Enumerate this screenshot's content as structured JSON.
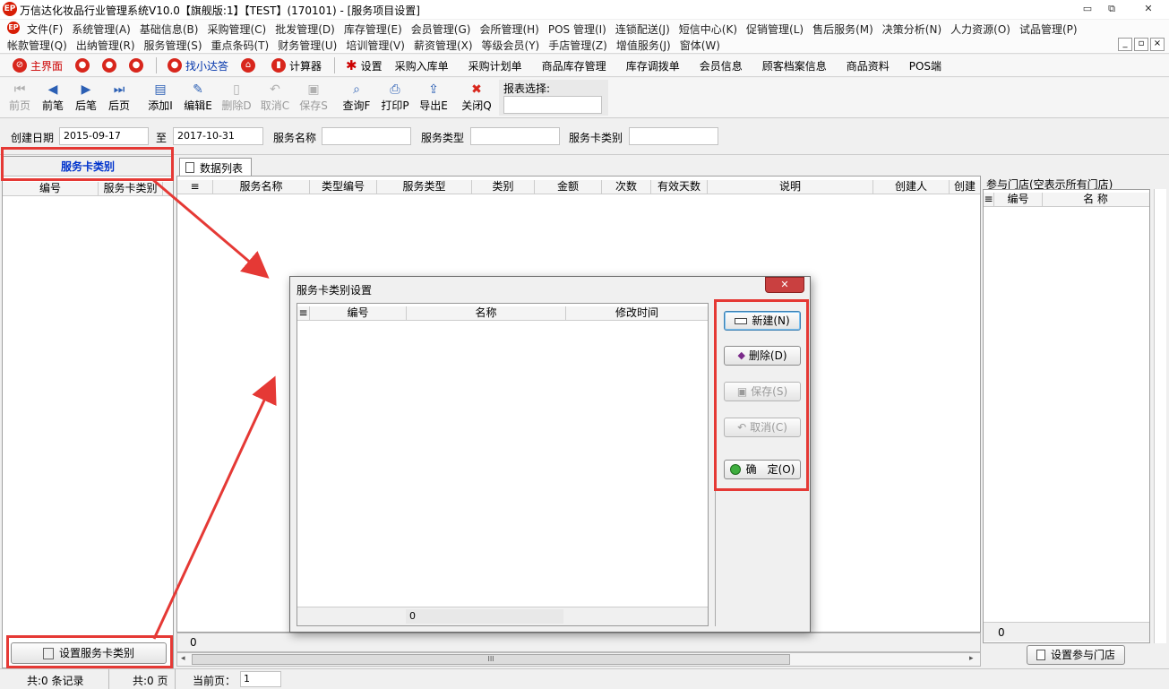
{
  "window": {
    "title": "万信达化妆品行业管理系统V10.0【旗舰版:1】【TEST】(170101) - [服务项目设置]",
    "logo": "EP",
    "min": "▭",
    "restore": "⧉",
    "close": "✕"
  },
  "menu": {
    "row1": [
      "文件(F)",
      "系统管理(A)",
      "基础信息(B)",
      "采购管理(C)",
      "批发管理(D)",
      "库存管理(E)",
      "会员管理(G)",
      "会所管理(H)",
      "POS 管理(I)",
      "连锁配送(J)",
      "短信中心(K)",
      "促销管理(L)",
      "售后服务(M)",
      "决策分析(N)",
      "人力资源(O)",
      "试品管理(P)"
    ],
    "row2": [
      "帐款管理(Q)",
      "出纳管理(R)",
      "服务管理(S)",
      "重点条码(T)",
      "财务管理(U)",
      "培训管理(V)",
      "薪资管理(X)",
      "等级会员(Y)",
      "手店管理(Z)",
      "增值服务(J)",
      "窗体(W)"
    ],
    "mdi_controls": [
      "_",
      "▫",
      "×"
    ]
  },
  "quickbar": {
    "home": "主界面",
    "find": "找小达答",
    "calc": "计算器",
    "settings": "设置",
    "links": [
      "采购入库单",
      "采购计划单",
      "商品库存管理",
      "库存调拨单",
      "会员信息",
      "顾客档案信息",
      "商品资料",
      "POS端"
    ]
  },
  "toolbar": {
    "buttons": [
      "前页",
      "前笔",
      "后笔",
      "后页",
      "添加I",
      "编辑E",
      "删除D",
      "取消C",
      "保存S",
      "查询F",
      "打印P",
      "导出E",
      "关闭Q"
    ],
    "report_label": "报表选择:"
  },
  "filter": {
    "date_label": "创建日期",
    "date_from": "2015-09-17",
    "to_label": "至",
    "date_to": "2017-10-31",
    "name_label": "服务名称",
    "type_label": "服务类型",
    "cardtype_label": "服务卡类别"
  },
  "left": {
    "title": "服务卡类别",
    "columns": [
      "编号",
      "服务卡类别"
    ],
    "button": "设置服务卡类别"
  },
  "tab": {
    "label": "数据列表"
  },
  "grid": {
    "columns": [
      "服务名称",
      "类型编号",
      "服务类型",
      "类别",
      "金额",
      "次数",
      "有效天数",
      "说明",
      "创建人",
      "创建"
    ],
    "footer_value": "0",
    "scroll_thumb": "III"
  },
  "right": {
    "title": "参与门店(空表示所有门店)",
    "columns": [
      "编号",
      "名 称"
    ],
    "footer_value": "0",
    "button": "设置参与门店"
  },
  "dialog": {
    "title": "服务卡类别设置",
    "columns": [
      "编号",
      "名称",
      "修改时间"
    ],
    "footer_value": "0",
    "buttons": {
      "new": "新建(N)",
      "delete": "删除(D)",
      "save": "保存(S)",
      "cancel": "取消(C)",
      "ok": "确　定(O)"
    }
  },
  "status": {
    "records": "共:0 条记录",
    "pages": "共:0 页",
    "current_label": "当前页：",
    "current_value": "1"
  },
  "colors": {
    "annotation": "#e53935",
    "title_blue": "#0033cc",
    "accent": "#d8261c"
  }
}
